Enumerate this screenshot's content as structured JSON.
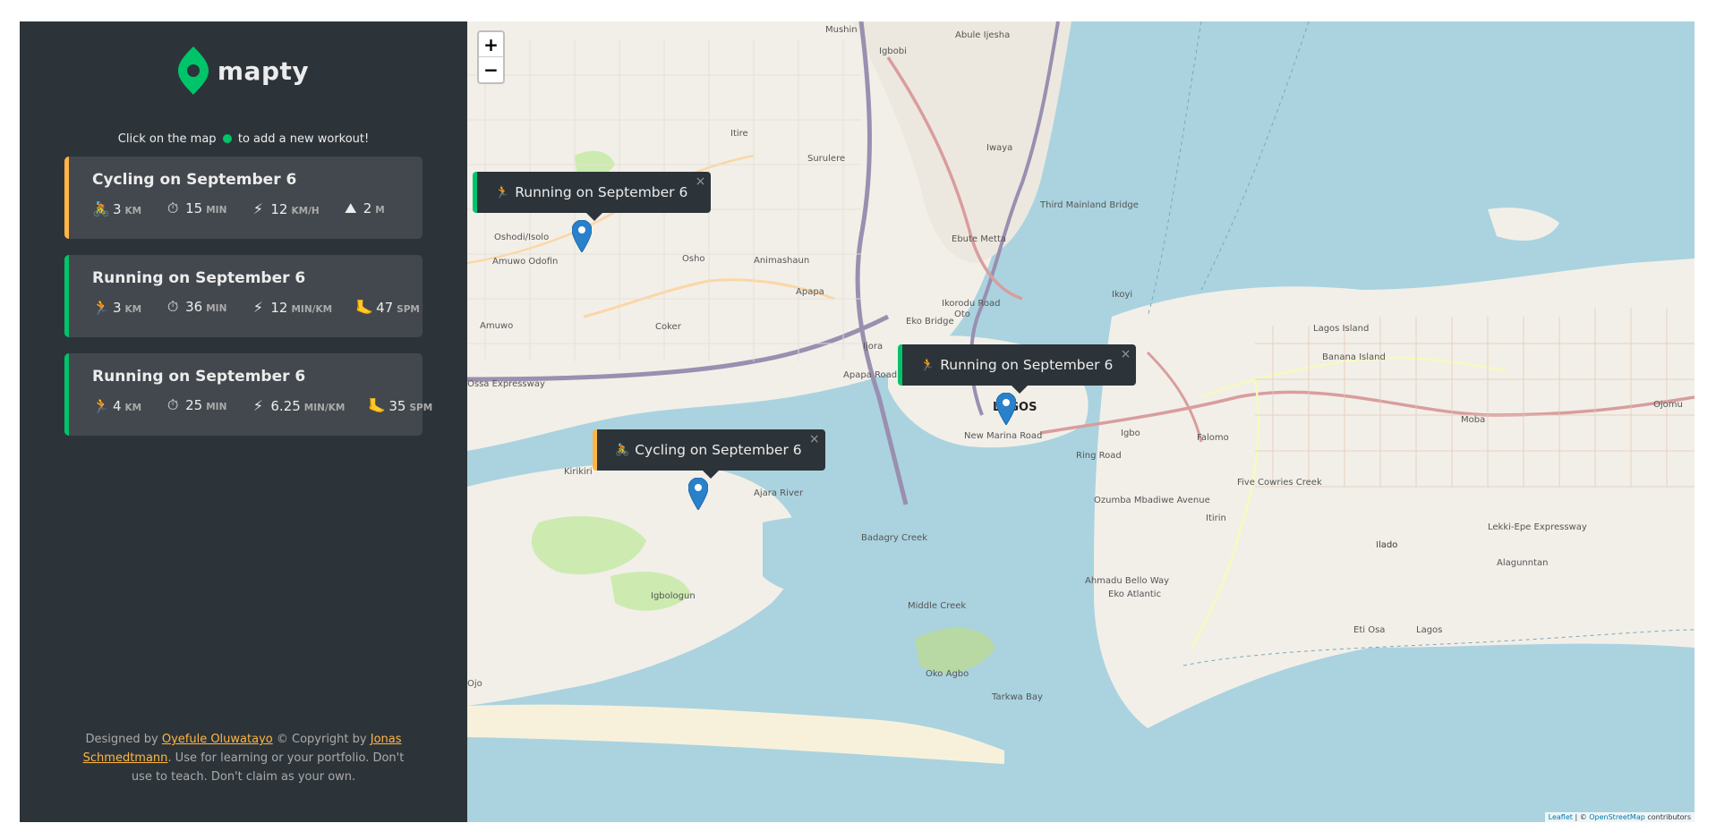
{
  "app": {
    "logo_text": "mapty",
    "hint_before": "Click on the map",
    "hint_after": "to add a new workout!"
  },
  "workouts": [
    {
      "type": "cycling",
      "title": "Cycling on September 6",
      "details": [
        {
          "icon": "bicycle-icon",
          "glyph": "🚴",
          "value": "3",
          "unit": "km"
        },
        {
          "icon": "stopwatch-icon",
          "glyph": "⏱",
          "value": "15",
          "unit": "min"
        },
        {
          "icon": "lightning-icon",
          "glyph": "⚡",
          "value": "12",
          "unit": "km/h"
        },
        {
          "icon": "mountain-icon",
          "glyph": "⛰",
          "value": "2",
          "unit": "m"
        }
      ]
    },
    {
      "type": "running",
      "title": "Running on September 6",
      "details": [
        {
          "icon": "runner-icon",
          "glyph": "🏃",
          "value": "3",
          "unit": "km"
        },
        {
          "icon": "stopwatch-icon",
          "glyph": "⏱",
          "value": "36",
          "unit": "min"
        },
        {
          "icon": "lightning-icon",
          "glyph": "⚡",
          "value": "12",
          "unit": "min/km"
        },
        {
          "icon": "footprint-icon",
          "glyph": "🦶",
          "value": "47",
          "unit": "spm"
        }
      ]
    },
    {
      "type": "running",
      "title": "Running on September 6",
      "details": [
        {
          "icon": "runner-icon",
          "glyph": "🏃",
          "value": "4",
          "unit": "km"
        },
        {
          "icon": "stopwatch-icon",
          "glyph": "⏱",
          "value": "25",
          "unit": "min"
        },
        {
          "icon": "lightning-icon",
          "glyph": "⚡",
          "value": "6.25",
          "unit": "min/km"
        },
        {
          "icon": "footprint-icon",
          "glyph": "🦶",
          "value": "35",
          "spm": "",
          "unit": "spm"
        }
      ]
    }
  ],
  "footer": {
    "designed_by": "Designed by",
    "designer": "Oyefule Oluwatayo",
    "copyright_by": "© Copyright by",
    "author": "Jonas Schmedtmann",
    "rest": ". Use for learning or your portfolio. Don't use to teach. Don't claim as your own."
  },
  "map": {
    "zoom_in": "+",
    "zoom_out": "−",
    "popups": [
      {
        "type": "running",
        "glyph": "🏃",
        "label": "Running on September 6",
        "close": "×"
      },
      {
        "type": "running",
        "glyph": "🏃",
        "label": "Running on September 6",
        "close": "×"
      },
      {
        "type": "cycling",
        "glyph": "🚴",
        "label": "Cycling on September 6",
        "close": "×"
      }
    ],
    "labels": [
      "Lagos Island",
      "LAGOS",
      "Ikoyi",
      "Apapa",
      "Ijora",
      "Surulere",
      "Mushin",
      "Itire",
      "Iwaya",
      "Ebute Metta",
      "Igbobi",
      "Abule Ijesha",
      "Oshodi/Isolo",
      "Amuwo Odofin",
      "Amuwo",
      "Coker",
      "Kirikiri",
      "Igbologun",
      "Oko Agbo",
      "Tarkwa Bay",
      "Eko Atlantic",
      "Eti Osa",
      "Lagos",
      "Ilado",
      "Itirin",
      "Falomo",
      "Banana Island",
      "Moba",
      "Ojomu",
      "Alagunntan",
      "Ilado",
      "Ajara River",
      "Badagry Creek",
      "Middle Creek",
      "Lekki-Epe Expressway",
      "Ozumba Mbadiwe Avenue",
      "New Marina Road",
      "Third Mainland Bridge",
      "Eko Bridge",
      "Ikorodu Road",
      "Apapa Road",
      "Ring Road",
      "Ahmadu Bello Way",
      "Five Cowries Creek",
      "Ossa Expressway",
      "Animashaun",
      "Osho",
      "Igbo",
      "Oto",
      "Ojo"
    ],
    "attribution_leaflet": "Leaflet",
    "attribution_sep": " | © ",
    "attribution_osm": "OpenStreetMap",
    "attribution_tail": " contributors"
  },
  "colors": {
    "sidebar_bg": "#2d3439",
    "card_bg": "#42484d",
    "brand_green": "#00c46a",
    "brand_yellow": "#ffb545",
    "water": "#aad3df",
    "land": "#f2efe9"
  }
}
